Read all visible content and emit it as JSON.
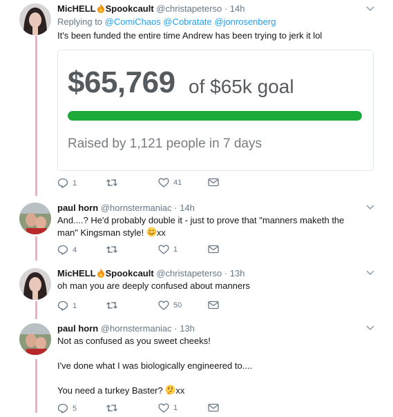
{
  "tweets": [
    {
      "name": "MicHELL",
      "name_suffix": "Spookcault",
      "handle": "@christapeterso",
      "time": "· 14h",
      "replying_label": "Replying to",
      "replying_to": [
        "@ComiChaos",
        "@Cobratate",
        "@jonrosenberg"
      ],
      "text": "It's been funded the entire time Andrew has been trying to jerk it lol",
      "card": {
        "amount": "$65,769",
        "goal_text": "of $65k goal",
        "progress_fraction": 1.0,
        "raised_text": "Raised by 1,121 people in 7 days",
        "bar_color": "#1cab3a"
      },
      "actions": {
        "replies": "1",
        "retweets": "",
        "likes": "41"
      }
    },
    {
      "name": "paul horn",
      "handle": "@hornstermaniac",
      "time": "· 14h",
      "text_1": "And....? He'd probably double it - just to prove that \"manners maketh the",
      "text_2_prefix": "man\" Kingsman style!",
      "text_2_suffix": "xx",
      "actions": {
        "replies": "4",
        "retweets": "",
        "likes": "1"
      }
    },
    {
      "name": "MicHELL",
      "name_suffix": "Spookcault",
      "handle": "@christapeterso",
      "time": "· 13h",
      "text": "oh man you are deeply confused about manners",
      "actions": {
        "replies": "1",
        "retweets": "",
        "likes": "50"
      }
    },
    {
      "name": "paul horn",
      "handle": "@hornstermaniac",
      "time": "· 13h",
      "line_1": "Not as confused as you sweet cheeks!",
      "line_2": "I've done what I was biologically engineered to....",
      "line_3_prefix": "You need a turkey Baster?",
      "line_3_suffix": "xx",
      "actions": {
        "replies": "5",
        "retweets": "",
        "likes": "1"
      }
    }
  ],
  "colors": {
    "thread_line": "#f4a9c4",
    "link": "#1da1f2",
    "muted": "#657786"
  }
}
